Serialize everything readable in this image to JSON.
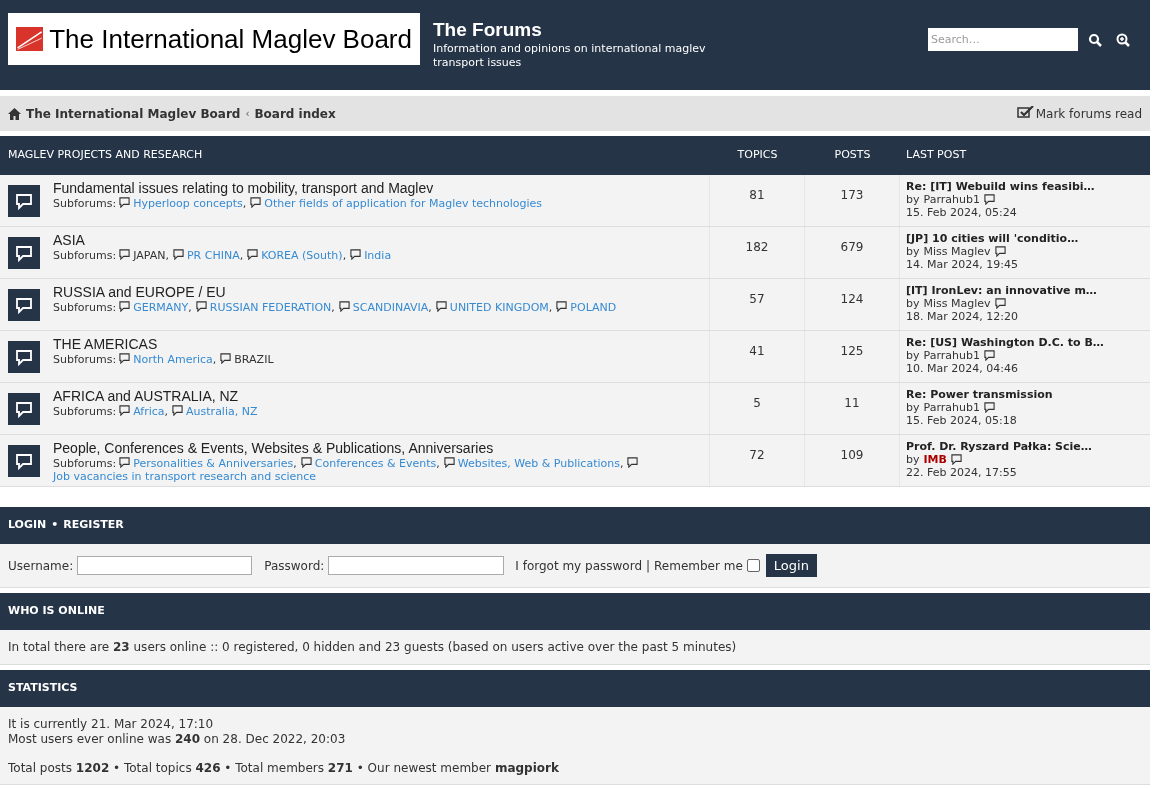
{
  "header": {
    "logo_text": "The International Maglev Board",
    "site_title": "The Forums",
    "site_description": "Information and opinions on international maglev transport issues",
    "search": {
      "placeholder": "Search…"
    }
  },
  "breadcrumb": {
    "items": [
      "The International Maglev Board",
      "Board index"
    ],
    "separator": "‹",
    "subforum_separator": ",",
    "mark_read": "Mark forums read"
  },
  "forum_table": {
    "category": "MAGLEV PROJECTS AND RESEARCH",
    "columns": [
      "TOPICS",
      "POSTS",
      "LAST POST"
    ],
    "rows": [
      {
        "title": "Fundamental issues relating to mobility, transport and Maglev",
        "subforums_label": "Subforums:",
        "subforums": [
          {
            "name": "Hyperloop concepts",
            "linked": true
          },
          {
            "name": "Other fields of application for Maglev technologies",
            "linked": true
          }
        ],
        "topics": "81",
        "posts": "173",
        "last_post": {
          "title": "Re: [IT] Webuild wins feasibi…",
          "by": "by",
          "author": "Parrahub1",
          "kind": "user",
          "color": "#333333",
          "date": "15. Feb 2024, 05:24"
        }
      },
      {
        "title": "ASIA",
        "subforums_label": "Subforums:",
        "subforums": [
          {
            "name": "JAPAN",
            "linked": false
          },
          {
            "name": "PR CHINA",
            "linked": true
          },
          {
            "name": "KOREA (South)",
            "linked": true
          },
          {
            "name": "India",
            "linked": true
          }
        ],
        "topics": "182",
        "posts": "679",
        "last_post": {
          "title": "[JP] 10 cities will 'conditio…",
          "by": "by",
          "author": "Miss Maglev",
          "kind": "user",
          "color": "#333333",
          "date": "14. Mar 2024, 19:45"
        }
      },
      {
        "title": "RUSSIA and EUROPE / EU",
        "subforums_label": "Subforums:",
        "subforums": [
          {
            "name": "GERMANY",
            "linked": true
          },
          {
            "name": "RUSSIAN FEDERATION",
            "linked": true
          },
          {
            "name": "SCANDINAVIA",
            "linked": true
          },
          {
            "name": "UNITED KINGDOM",
            "linked": true
          },
          {
            "name": "POLAND",
            "linked": true
          }
        ],
        "topics": "57",
        "posts": "124",
        "last_post": {
          "title": "[IT] IronLev: an innovative m…",
          "by": "by",
          "author": "Miss Maglev",
          "kind": "user",
          "color": "#333333",
          "date": "18. Mar 2024, 12:20"
        }
      },
      {
        "title": "THE AMERICAS",
        "subforums_label": "Subforums:",
        "subforums": [
          {
            "name": "North America",
            "linked": true
          },
          {
            "name": "BRAZIL",
            "linked": false
          }
        ],
        "topics": "41",
        "posts": "125",
        "last_post": {
          "title": "Re: [US] Washington D.C. to B…",
          "by": "by",
          "author": "Parrahub1",
          "kind": "user",
          "color": "#333333",
          "date": "10. Mar 2024, 04:46"
        }
      },
      {
        "title": "AFRICA and AUSTRALIA, NZ",
        "subforums_label": "Subforums:",
        "subforums": [
          {
            "name": "Africa",
            "linked": true
          },
          {
            "name": "Australia, NZ",
            "linked": true
          }
        ],
        "topics": "5",
        "posts": "11",
        "last_post": {
          "title": "Re: Power transmission",
          "by": "by",
          "author": "Parrahub1",
          "kind": "user",
          "color": "#333333",
          "date": "15. Feb 2024, 05:18"
        }
      },
      {
        "title": "People, Conferences & Events, Websites & Publications, Anniversaries",
        "subforums_label": "Subforums:",
        "subforums": [
          {
            "name": "Personalities & Anniversaries",
            "linked": true
          },
          {
            "name": "Conferences & Events",
            "linked": true
          },
          {
            "name": "Websites, Web & Publications",
            "linked": true
          },
          {
            "name": "Job vacancies in transport research and science",
            "linked": true
          }
        ],
        "topics": "72",
        "posts": "109",
        "last_post": {
          "title": "Prof. Dr. Ryszard Pałka: Scie…",
          "by": "by",
          "author": "IMB",
          "kind": "admin",
          "color": "#aa0000",
          "date": "22. Feb 2024, 17:55"
        }
      }
    ]
  },
  "login": {
    "links": [
      "LOGIN",
      "REGISTER"
    ],
    "separator": "•",
    "username_label": "Username:",
    "password_label": "Password:",
    "forgot": "I forgot my password",
    "divider": "|",
    "remember_label": "Remember me",
    "remember_checked": false,
    "button": "Login"
  },
  "who_is_online": {
    "heading": "WHO IS ONLINE",
    "text": "In total there are **23** users online :: 0 registered, 0 hidden and 23 guests (based on users active over the past 5 minutes)"
  },
  "statistics": {
    "heading": "STATISTICS",
    "lines": [
      "It is currently 21. Mar 2024, 17:10",
      "Most users ever online was **240** on 28. Dec 2022, 20:03"
    ],
    "totals": "Total posts **1202** • Total topics **426** • Total members **271** • Our newest member **magpiork**"
  }
}
